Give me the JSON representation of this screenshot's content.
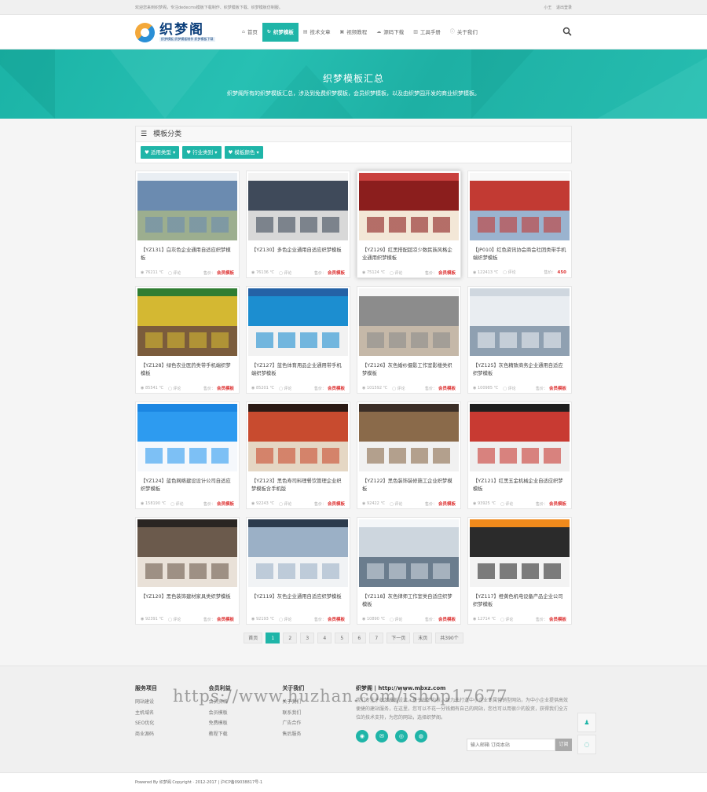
{
  "topbar": {
    "welcome": "欢迎您来到织梦阁，专注dedecms模板下载制作、织梦模板下载、织梦模板仿制服。",
    "user": "小王",
    "logout": "退出登录"
  },
  "logo": {
    "name": "织梦阁",
    "sub": "织梦模板 织梦模板制作 织梦模板下载"
  },
  "nav": [
    {
      "label": "首页",
      "icon": "home-icon",
      "glyph": "⌂"
    },
    {
      "label": "织梦模板",
      "icon": "refresh-icon",
      "glyph": "↻",
      "active": true
    },
    {
      "label": "技术文章",
      "icon": "file-icon",
      "glyph": "▤"
    },
    {
      "label": "视频教程",
      "icon": "video-icon",
      "glyph": "▣"
    },
    {
      "label": "源码下载",
      "icon": "cloud-icon",
      "glyph": "☁"
    },
    {
      "label": "工具手册",
      "icon": "book-icon",
      "glyph": "▥"
    },
    {
      "label": "关于我们",
      "icon": "info-icon",
      "glyph": "ⓘ"
    }
  ],
  "banner": {
    "title": "织梦模板汇总",
    "subtitle": "织梦阁所有的织梦模板汇总，涉及到免费织梦模板，会员织梦模板，以及由织梦园开发的商业织梦模板。"
  },
  "category": {
    "title": "模板分类",
    "filters": [
      "适用类型",
      "行业类别",
      "模板颜色"
    ]
  },
  "cards": [
    {
      "title": "【YZ131】白灰色企业通用自适应织梦模板",
      "views": "76211",
      "comment": "评论",
      "price_label": "售价：",
      "price": "会员模板",
      "colors": [
        "#e9eef3",
        "#6b8bb0",
        "#9cae8f"
      ]
    },
    {
      "title": "【YZ130】多色企业通用自适应织梦模板",
      "views": "76136",
      "comment": "评论",
      "price_label": "售价：",
      "price": "会员模板",
      "colors": [
        "#f3f3f3",
        "#3f4a5a",
        "#d8d8d8"
      ]
    },
    {
      "title": "【YZ129】红黑搭配超凉少数民族风格企业通用织梦模板",
      "views": "75124",
      "comment": "评论",
      "price_label": "售价：",
      "price": "会员模板",
      "colors": [
        "#c9403d",
        "#8b1e1d",
        "#f3e7d7"
      ],
      "highlight": true
    },
    {
      "title": "【JP010】红色资讯协会商会社团类带手机端织梦模板",
      "views": "122413",
      "comment": "评论",
      "price_label": "售价：",
      "price": "450",
      "colors": [
        "#f8f8f8",
        "#c23a33",
        "#9ab3cf"
      ]
    },
    {
      "title": "【YZ128】绿色农业医药类带手机端织梦模板",
      "views": "85541",
      "comment": "评论",
      "price_label": "售价：",
      "price": "会员模板",
      "colors": [
        "#2f7d32",
        "#d4b832",
        "#7b5c3c"
      ]
    },
    {
      "title": "【YZ127】蓝色体育用品企业通用带手机端织梦模板",
      "views": "85201",
      "comment": "评论",
      "price_label": "售价：",
      "price": "会员模板",
      "colors": [
        "#2462a6",
        "#1c8ed0",
        "#f2f2f2"
      ]
    },
    {
      "title": "【YZ126】灰色婚纱摄影工作室影楼类织梦模板",
      "views": "101592",
      "comment": "评论",
      "price_label": "售价：",
      "price": "会员模板",
      "colors": [
        "#f6f6f6",
        "#8c8c8c",
        "#c5b8a8"
      ]
    },
    {
      "title": "【YZ125】灰色精致商务企业通用自适应织梦模板",
      "views": "100985",
      "comment": "评论",
      "price_label": "售价：",
      "price": "会员模板",
      "colors": [
        "#cfd7df",
        "#e9edf1",
        "#8fa0b1"
      ]
    },
    {
      "title": "【YZ124】蓝色网络建设设计公司自适应织梦模板",
      "views": "158190",
      "comment": "评论",
      "price_label": "售价：",
      "price": "会员模板",
      "colors": [
        "#1b86e2",
        "#2d9bf0",
        "#f5f8fc"
      ]
    },
    {
      "title": "【YZ123】黑色寿司料理餐饮管理企业织梦模板含手机版",
      "views": "92243",
      "comment": "评论",
      "price_label": "售价：",
      "price": "会员模板",
      "colors": [
        "#2b1a15",
        "#c84b2f",
        "#e5d7c4"
      ]
    },
    {
      "title": "【YZ122】黑色装饰装修施工企业织梦模板",
      "views": "92422",
      "comment": "评论",
      "price_label": "售价：",
      "price": "会员模板",
      "colors": [
        "#3b2e27",
        "#8a6a4a",
        "#f1f1f1"
      ]
    },
    {
      "title": "【YZ121】红黑五金机械企业自适应织梦模板",
      "views": "93925",
      "comment": "评论",
      "price_label": "售价：",
      "price": "会员模板",
      "colors": [
        "#1f1f1f",
        "#c83a32",
        "#efefef"
      ]
    },
    {
      "title": "【YZ120】黑色装饰建材家具类织梦模板",
      "views": "92391",
      "comment": "评论",
      "price_label": "售价：",
      "price": "会员模板",
      "colors": [
        "#2a2522",
        "#6b5a4c",
        "#e9e1d8"
      ]
    },
    {
      "title": "【YZ119】灰色企业通用自适应织梦模板",
      "views": "92193",
      "comment": "评论",
      "price_label": "售价：",
      "price": "会员模板",
      "colors": [
        "#2c3b4d",
        "#9bb0c6",
        "#f1f3f5"
      ]
    },
    {
      "title": "【YZ118】灰色律师工作室类自适应织梦模板",
      "views": "10890",
      "comment": "评论",
      "price_label": "售价：",
      "price": "会员模板",
      "colors": [
        "#f4f6f8",
        "#cdd6de",
        "#6b7d8e"
      ]
    },
    {
      "title": "【YZ117】橙黄色机电设备产品企业公司织梦模板",
      "views": "12714",
      "comment": "评论",
      "price_label": "售价：",
      "price": "会员模板",
      "colors": [
        "#f08a1c",
        "#2b2b2b",
        "#f3f3f3"
      ]
    }
  ],
  "pager": {
    "first": "首页",
    "pages": [
      "1",
      "2",
      "3",
      "4",
      "5",
      "6",
      "7"
    ],
    "current": "1",
    "next": "下一页",
    "last": "末页",
    "total": "共390个"
  },
  "footer": {
    "cols": [
      {
        "title": "服务项目",
        "links": [
          "网站建设",
          "主机域名",
          "SEO优化",
          "商业源码"
        ]
      },
      {
        "title": "会员利益",
        "links": [
          "会员资格",
          "会员模板",
          "免费模板",
          "教程下载"
        ]
      },
      {
        "title": "关于我们",
        "links": [
          "关于我们",
          "联系我们",
          "广告合作",
          "售后服务"
        ]
      }
    ],
    "about_title": "织梦阁 | http://www.mbxz.com",
    "about_desc": "我们专注于织梦模板设计，基于织梦内核，致力于打造中小企业专属营销型网站，为中小企业提供高效便捷的建站服务，在这里，您可以不花一分钱拥有自己的网站，您也可以用很少的投资，获得我们全方位的技术支持，为您的网站，选择织梦阁。",
    "subscribe_placeholder": "输入邮箱 订阅本站",
    "subscribe_button": "订阅",
    "copyright": "Powered By 织梦阁 Copyright · 2012-2017 | 沪ICP备09038817号-1"
  },
  "watermark": "https://www.huzhan.com/ishop17677"
}
